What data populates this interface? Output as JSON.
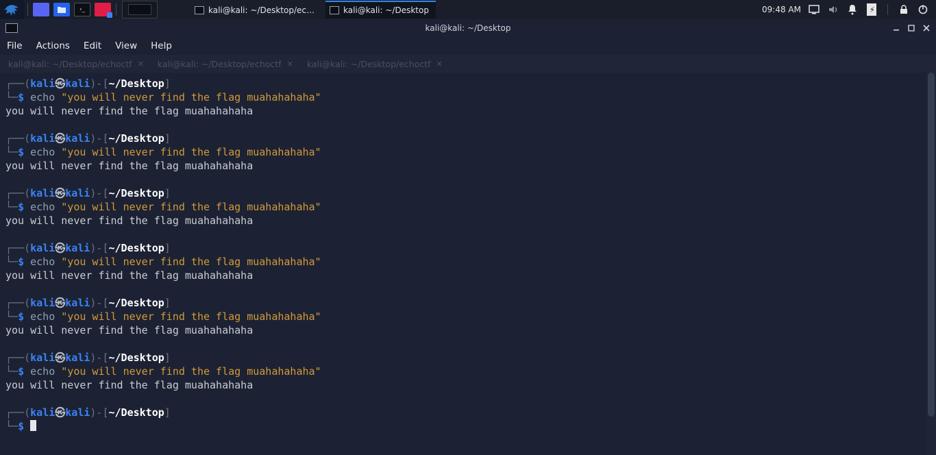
{
  "panel": {
    "taskbar": [
      {
        "label": "kali@kali: ~/Desktop/ec…",
        "active": false
      },
      {
        "label": "kali@kali: ~/Desktop",
        "active": true
      }
    ],
    "clock": "09:48 AM"
  },
  "window": {
    "title": "kali@kali: ~/Desktop"
  },
  "menubar": [
    "File",
    "Actions",
    "Edit",
    "View",
    "Help"
  ],
  "tabs": [
    "kali@kali: ~/Desktop/echoctf",
    "kali@kali: ~/Desktop/echoctf",
    "kali@kali: ~/Desktop/echoctf"
  ],
  "prompt": {
    "user": "kali",
    "host": "kali",
    "path": "~/Desktop",
    "cmd": "echo",
    "arg": "\"you will never find the flag muahahahaha\"",
    "out": "you will never find the flag muahahahaha",
    "repeats": 6
  }
}
